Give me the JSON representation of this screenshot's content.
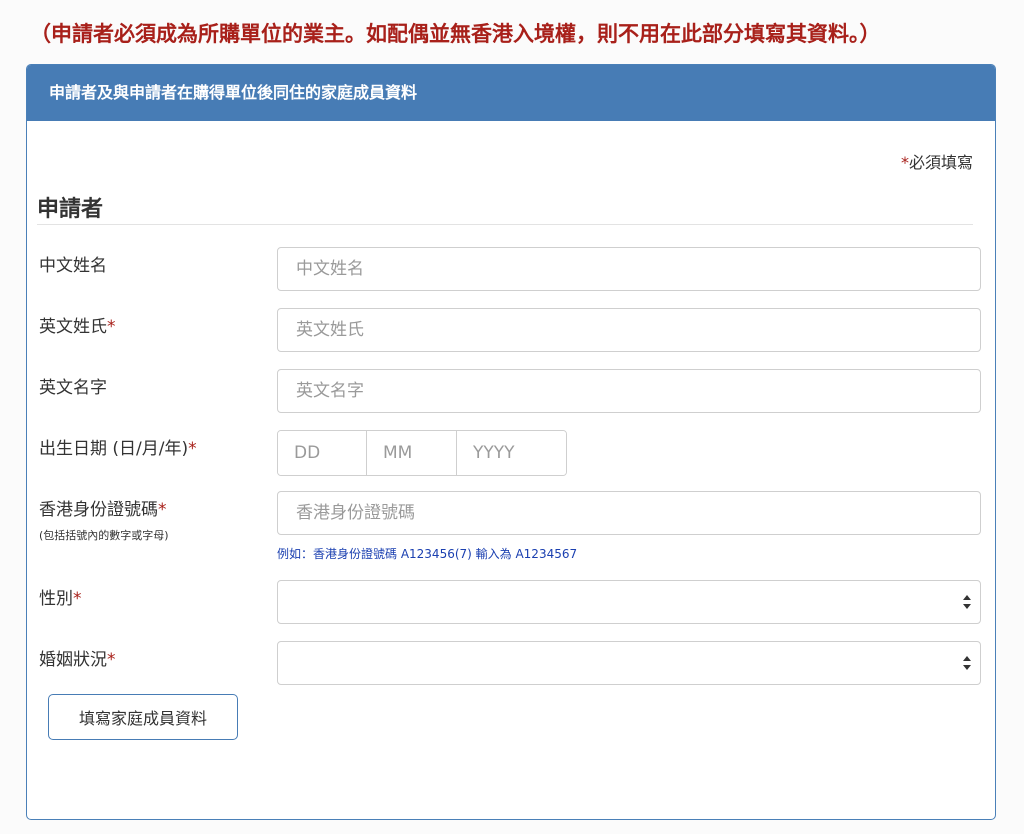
{
  "notice": "（申請者必須成為所購單位的業主。如配偶並無香港入境權，則不用在此部分填寫其資料。）",
  "panel": {
    "title": "申請者及與申請者在購得單位後同住的家庭成員資料",
    "required_note": "必須填寫",
    "required_mark": "*"
  },
  "section": {
    "title": "申請者"
  },
  "fields": {
    "chinese_name": {
      "label": "中文姓名",
      "placeholder": "中文姓名"
    },
    "english_surname": {
      "label": "英文姓氏",
      "placeholder": "英文姓氏"
    },
    "english_given_name": {
      "label": "英文名字",
      "placeholder": "英文名字"
    },
    "dob": {
      "label": "出生日期 (日/月/年)",
      "day_placeholder": "DD",
      "month_placeholder": "MM",
      "year_placeholder": "YYYY"
    },
    "hkid": {
      "label": "香港身份證號碼",
      "sub_label": "(包括括號內的數字或字母)",
      "placeholder": "香港身份證號碼",
      "hint": "例如：香港身份證號碼 A123456(7) 輸入為 A1234567"
    },
    "gender": {
      "label": "性別",
      "value": ""
    },
    "marital_status": {
      "label": "婚姻狀況",
      "value": ""
    }
  },
  "buttons": {
    "family_members": "填寫家庭成員資料"
  },
  "colors": {
    "header_bg": "#477cb5",
    "notice_red": "#a8201a",
    "hint_blue": "#1a3fb0"
  }
}
